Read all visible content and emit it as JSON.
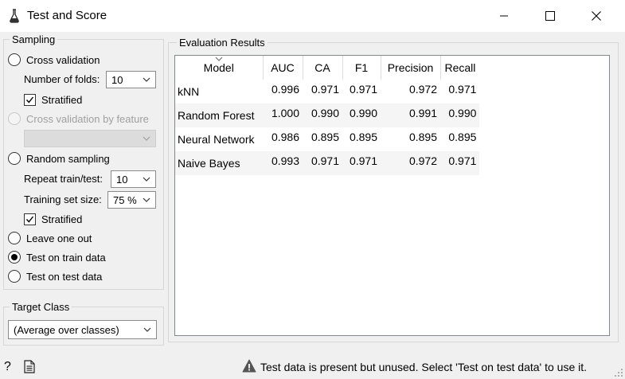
{
  "window": {
    "title": "Test and Score",
    "icon": "flask-icon",
    "buttons": [
      "minimize",
      "maximize",
      "close"
    ]
  },
  "sampling": {
    "title": "Sampling",
    "cross_validation": {
      "label": "Cross validation",
      "selected": false
    },
    "folds": {
      "label": "Number of folds:",
      "value": "10"
    },
    "cv_stratified": {
      "label": "Stratified",
      "checked": true
    },
    "cv_by_feature": {
      "label": "Cross validation by feature",
      "enabled": false,
      "value": ""
    },
    "random_sampling": {
      "label": "Random sampling",
      "selected": false
    },
    "repeat": {
      "label": "Repeat train/test:",
      "value": "10"
    },
    "train_size": {
      "label": "Training set size:",
      "value": "75 %"
    },
    "rs_stratified": {
      "label": "Stratified",
      "checked": true
    },
    "leave_one_out": {
      "label": "Leave one out",
      "selected": false
    },
    "test_on_train": {
      "label": "Test on train data",
      "selected": true
    },
    "test_on_test": {
      "label": "Test on test data",
      "selected": false
    }
  },
  "target_class": {
    "title": "Target Class",
    "value": "(Average over classes)"
  },
  "results": {
    "title": "Evaluation Results",
    "columns": [
      "Model",
      "AUC",
      "CA",
      "F1",
      "Precision",
      "Recall"
    ],
    "sorted_column": "Model",
    "rows": [
      {
        "model": "kNN",
        "auc": "0.996",
        "ca": "0.971",
        "f1": "0.971",
        "precision": "0.972",
        "recall": "0.971"
      },
      {
        "model": "Random Forest",
        "auc": "1.000",
        "ca": "0.990",
        "f1": "0.990",
        "precision": "0.991",
        "recall": "0.990"
      },
      {
        "model": "Neural Network",
        "auc": "0.986",
        "ca": "0.895",
        "f1": "0.895",
        "precision": "0.895",
        "recall": "0.895"
      },
      {
        "model": "Naive Bayes",
        "auc": "0.993",
        "ca": "0.971",
        "f1": "0.971",
        "precision": "0.972",
        "recall": "0.971"
      }
    ]
  },
  "status": {
    "help": "?",
    "warning_icon": "warning-icon",
    "message": "Test data is present but unused. Select 'Test on test data' to use it."
  }
}
